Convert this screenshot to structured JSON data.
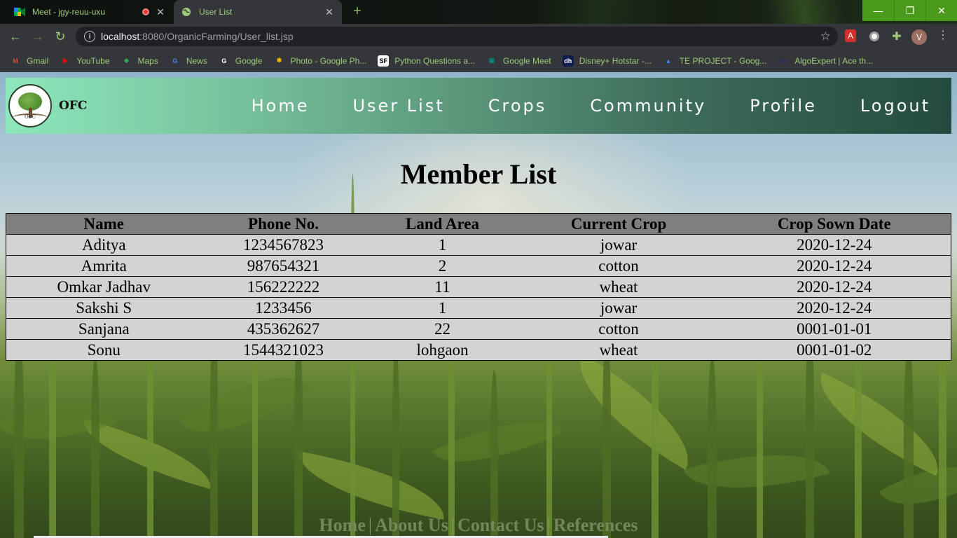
{
  "browser": {
    "tabs": [
      {
        "title": "Meet - jgy-reuu-uxu",
        "icon": "google-meet-icon",
        "recording": true
      },
      {
        "title": "User List",
        "icon": "globe-icon",
        "active": true
      }
    ],
    "url_host": "localhost",
    "url_rest": ":8080/OrganicFarming/User_list.jsp",
    "profile_initial": "V",
    "bookmarks": [
      {
        "label": "Gmail",
        "icon": "gmail-icon",
        "glyph": "M",
        "color": "#ea4335"
      },
      {
        "label": "YouTube",
        "icon": "youtube-icon",
        "glyph": "▶",
        "color": "#ff0000"
      },
      {
        "label": "Maps",
        "icon": "maps-icon",
        "glyph": "◆",
        "color": "#34a853"
      },
      {
        "label": "News",
        "icon": "news-icon",
        "glyph": "G",
        "color": "#4285f4"
      },
      {
        "label": "Google",
        "icon": "google-icon",
        "glyph": "G",
        "color": "#ffffff"
      },
      {
        "label": "Photo - Google Ph...",
        "icon": "photos-icon",
        "glyph": "✱",
        "color": "#fbbc04"
      },
      {
        "label": "Python Questions a...",
        "icon": "sanfoundry-icon",
        "glyph": "SF",
        "color": "#000000"
      },
      {
        "label": "Google Meet",
        "icon": "google-meet-icon",
        "glyph": "▣",
        "color": "#00897b"
      },
      {
        "label": "Disney+ Hotstar -...",
        "icon": "hotstar-icon",
        "glyph": "dh",
        "color": "#0f1c4d"
      },
      {
        "label": "TE PROJECT - Goog...",
        "icon": "google-drive-icon",
        "glyph": "▲",
        "color": "#4285f4"
      },
      {
        "label": "AlgoExpert | Ace th...",
        "icon": "algoexpert-icon",
        "glyph": "◇",
        "color": "#1a237e"
      }
    ]
  },
  "site": {
    "brand": "OFC",
    "logo_text": "OFC",
    "nav": [
      "Home",
      "User List",
      "Crops",
      "Community",
      "Profile",
      "Logout"
    ],
    "heading": "Member List",
    "table": {
      "headers": [
        "Name",
        "Phone No.",
        "Land Area",
        "Current Crop",
        "Crop Sown Date"
      ],
      "rows": [
        [
          "Aditya",
          "1234567823",
          "1",
          "jowar",
          "2020-12-24"
        ],
        [
          "Amrita",
          "987654321",
          "2",
          "cotton",
          "2020-12-24"
        ],
        [
          "Omkar Jadhav",
          "156222222",
          "11",
          "wheat",
          "2020-12-24"
        ],
        [
          "Sakshi S",
          "1233456",
          "1",
          "jowar",
          "2020-12-24"
        ],
        [
          "Sanjana",
          "435362627",
          "22",
          "cotton",
          "0001-01-01"
        ],
        [
          "Sonu",
          "1544321023",
          "lohgaon",
          "wheat",
          "0001-01-02"
        ]
      ]
    },
    "footer_links": [
      "Home",
      "About Us",
      "Contact Us",
      "References"
    ]
  }
}
